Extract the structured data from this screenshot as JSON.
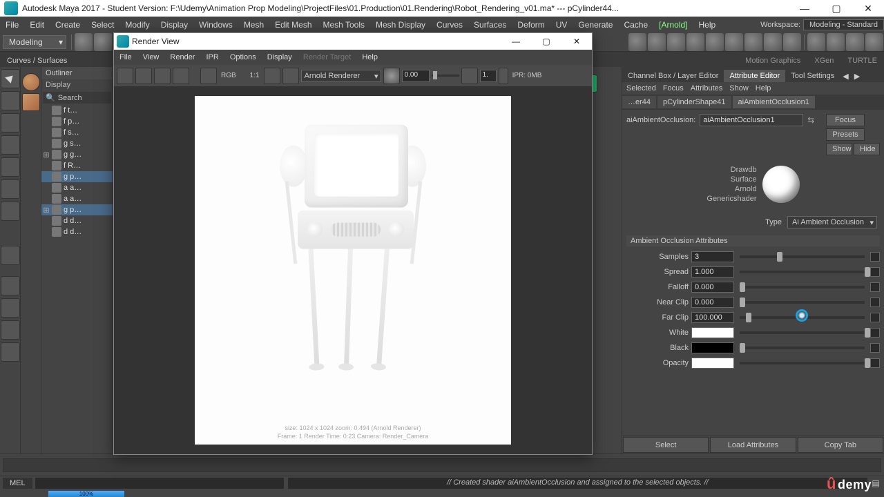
{
  "title": "Autodesk Maya 2017 - Student Version: F:\\Udemy\\Animation Prop Modeling\\ProjectFiles\\01.Production\\01.Rendering\\Robot_Rendering_v01.ma*  ---  pCylinder44...",
  "menubar": [
    "File",
    "Edit",
    "Create",
    "Select",
    "Modify",
    "Display",
    "Windows",
    "Mesh",
    "Edit Mesh",
    "Mesh Tools",
    "Mesh Display",
    "Curves",
    "Surfaces",
    "Deform",
    "UV",
    "Generate",
    "Cache"
  ],
  "menubar_plugin": "[Arnold]",
  "menubar_help": "Help",
  "workspace_label": "Workspace:",
  "workspace_value": "Modeling - Standard",
  "shelf_mode": "Modeling",
  "tabs_visible": [
    "Curves / Surfaces"
  ],
  "tabs_far": [
    "Motion Graphics",
    "XGen",
    "TURTLE"
  ],
  "outliner": {
    "title": "Outliner",
    "display": "Display",
    "search": "Search",
    "items": [
      {
        "exp": "",
        "label": "f t…"
      },
      {
        "exp": "",
        "label": "f p…"
      },
      {
        "exp": "",
        "label": "f s…"
      },
      {
        "exp": "",
        "label": "g s…"
      },
      {
        "exp": "⊞",
        "label": "g g…"
      },
      {
        "exp": "",
        "label": "f R…"
      },
      {
        "exp": "",
        "label": "g p…",
        "sel": true
      },
      {
        "exp": "",
        "label": "a a…"
      },
      {
        "exp": "",
        "label": "a a…"
      },
      {
        "exp": "⊞",
        "label": "g p…",
        "sel": true
      },
      {
        "exp": "",
        "label": "d d…"
      },
      {
        "exp": "",
        "label": "d d…"
      }
    ]
  },
  "render_view": {
    "title": "Render View",
    "menu": [
      "File",
      "View",
      "Render",
      "IPR",
      "Options",
      "Display"
    ],
    "menu_disabled": "Render Target",
    "menu_help": "Help",
    "rgb": "RGB",
    "ratio": "1:1",
    "renderer": "Arnold Renderer",
    "exposure": "0.00",
    "gamma": "1.",
    "ipr_mem": "IPR: 0MB",
    "info1": "size: 1024 x 1024   zoom: 0.494          (Arnold Renderer)",
    "info2": "Frame: 1     Render Time: 0:23     Camera: Render_Camera"
  },
  "right_panel": {
    "tabs": [
      "Channel Box / Layer Editor",
      "Attribute Editor",
      "Tool Settings"
    ],
    "active_tab": 1,
    "menu": [
      "Selected",
      "Focus",
      "Attributes",
      "Show",
      "Help"
    ],
    "node_tabs": [
      "…er44",
      "pCylinderShape41",
      "aiAmbientOcclusion1"
    ],
    "active_node": 2,
    "side_buttons": [
      "Focus",
      "Presets",
      "Show",
      "Hide"
    ],
    "name_label": "aiAmbientOcclusion:",
    "name_value": "aiAmbientOcclusion1",
    "ball_labels": "Drawdb\nSurface\nArnold\nGenericshader",
    "type_label": "Type",
    "type_value": "Ai Ambient Occlusion",
    "section": "Ambient Occlusion Attributes",
    "attrs": [
      {
        "label": "Samples",
        "value": "3",
        "thumb": 30
      },
      {
        "label": "Spread",
        "value": "1.000",
        "thumb": 100
      },
      {
        "label": "Falloff",
        "value": "0.000",
        "thumb": 0
      },
      {
        "label": "Near Clip",
        "value": "0.000",
        "thumb": 0
      },
      {
        "label": "Far Clip",
        "value": "100.000",
        "thumb": 5
      },
      {
        "label": "White",
        "swatch": "#ffffff",
        "thumb": 100
      },
      {
        "label": "Black",
        "swatch": "#000000",
        "thumb": 0
      },
      {
        "label": "Opacity",
        "swatch": "#ffffff",
        "thumb": 100
      }
    ],
    "bottom": [
      "Select",
      "Load Attributes",
      "Copy Tab"
    ]
  },
  "cmd": {
    "mode": "MEL",
    "msg": "// Created shader aiAmbientOcclusion and assigned to the selected objects. //"
  },
  "progress": "100%",
  "udemy": "demy"
}
